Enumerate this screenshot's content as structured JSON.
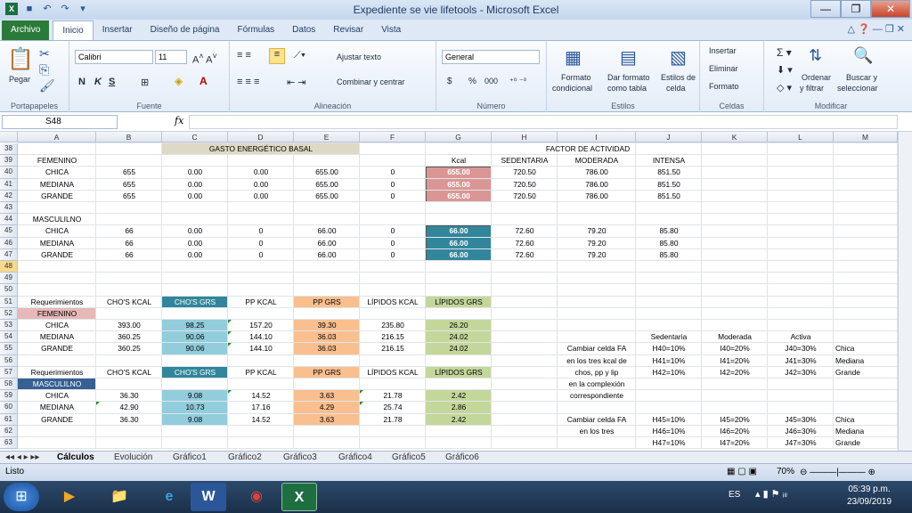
{
  "window": {
    "title": "Expediente se vie lifetools - Microsoft Excel",
    "minimize": "—",
    "restore": "❐",
    "close": "✕"
  },
  "ribbon_tabs": [
    "Archivo",
    "Inicio",
    "Insertar",
    "Diseño de página",
    "Fórmulas",
    "Datos",
    "Revisar",
    "Vista"
  ],
  "ribbon": {
    "portapapeles": {
      "paste": "Pegar",
      "label": "Portapapeles"
    },
    "fuente": {
      "font": "Calibri",
      "size": "11",
      "bold": "N",
      "italic": "K",
      "underline": "S",
      "label": "Fuente"
    },
    "alineacion": {
      "wrap": "Ajustar texto",
      "merge": "Combinar y centrar",
      "label": "Alineación"
    },
    "numero": {
      "format": "General",
      "label": "Número",
      "currency": "$",
      "percent": "%",
      "thousands": "000"
    },
    "estilos": {
      "cond1": "Formato",
      "cond2": "condicional",
      "table1": "Dar formato",
      "table2": "como tabla",
      "cell1": "Estilos de",
      "cell2": "celda",
      "label": "Estilos"
    },
    "celdas": {
      "insert": "Insertar",
      "delete": "Eliminar",
      "format": "Formato",
      "label": "Celdas"
    },
    "modificar": {
      "sort1": "Ordenar",
      "sort2": "y filtrar",
      "find1": "Buscar y",
      "find2": "seleccionar",
      "label": "Modificar"
    }
  },
  "formula_bar": {
    "name_box": "S48",
    "fx": "fx",
    "formula": ""
  },
  "columns": [
    "A",
    "B",
    "C",
    "D",
    "E",
    "F",
    "G",
    "H",
    "I",
    "J",
    "K",
    "L",
    "M"
  ],
  "rows": [
    "38",
    "39",
    "40",
    "41",
    "42",
    "43",
    "44",
    "45",
    "46",
    "47",
    "48",
    "49",
    "50",
    "51",
    "52",
    "53",
    "54",
    "55",
    "56",
    "57",
    "58",
    "59",
    "60",
    "61",
    "62",
    "63"
  ],
  "cells": {
    "r38": {
      "C": "GASTO ENERGÉTICO BASAL",
      "I": "FACTOR DE ACTIVIDAD"
    },
    "r39": {
      "A": "FEMENINO",
      "G": "Kcal",
      "H": "SEDENTARIA",
      "I": "MODERADA",
      "J": "INTENSA"
    },
    "r40": {
      "A": "CHICA",
      "B": "655",
      "C": "0.00",
      "D": "0.00",
      "E": "655.00",
      "F": "0",
      "G": "655.00",
      "H": "720.50",
      "I": "786.00",
      "J": "851.50"
    },
    "r41": {
      "A": "MEDIANA",
      "B": "655",
      "C": "0.00",
      "D": "0.00",
      "E": "655.00",
      "F": "0",
      "G": "655.00",
      "H": "720.50",
      "I": "786.00",
      "J": "851.50"
    },
    "r42": {
      "A": "GRANDE",
      "B": "655",
      "C": "0.00",
      "D": "0.00",
      "E": "655.00",
      "F": "0",
      "G": "655.00",
      "H": "720.50",
      "I": "786.00",
      "J": "851.50"
    },
    "r44": {
      "A": "MASCULILNO"
    },
    "r45": {
      "A": "CHICA",
      "B": "66",
      "C": "0.00",
      "D": "0",
      "E": "66.00",
      "F": "0",
      "G": "66.00",
      "H": "72.60",
      "I": "79.20",
      "J": "85.80"
    },
    "r46": {
      "A": "MEDIANA",
      "B": "66",
      "C": "0.00",
      "D": "0",
      "E": "66.00",
      "F": "0",
      "G": "66.00",
      "H": "72.60",
      "I": "79.20",
      "J": "85.80"
    },
    "r47": {
      "A": "GRANDE",
      "B": "66",
      "C": "0.00",
      "D": "0",
      "E": "66.00",
      "F": "0",
      "G": "66.00",
      "H": "72.60",
      "I": "79.20",
      "J": "85.80"
    },
    "r51": {
      "A": "Requerimientos",
      "B": "CHO'S KCAL",
      "C": "CHO'S GRS",
      "D": "PP KCAL",
      "E": "PP GRS",
      "F": "LÍPIDOS KCAL",
      "G": "LÍPIDOS GRS"
    },
    "r52": {
      "A": "FEMENINO"
    },
    "r53": {
      "A": "CHICA",
      "B": "393.00",
      "C": "98.25",
      "D": "157.20",
      "E": "39.30",
      "F": "235.80",
      "G": "26.20"
    },
    "r54": {
      "A": "MEDIANA",
      "B": "360.25",
      "C": "90.06",
      "D": "144.10",
      "E": "36.03",
      "F": "216.15",
      "G": "24.02",
      "J": "Sedentaria",
      "K": "Moderada",
      "L": "Activa"
    },
    "r55": {
      "A": "GRANDE",
      "B": "360.25",
      "C": "90.06",
      "D": "144.10",
      "E": "36.03",
      "F": "216.15",
      "G": "24.02",
      "I": "Cambiar celda FA",
      "J": "H40=10%",
      "K": "I40=20%",
      "L": "J40=30%",
      "M": "Chica"
    },
    "r56": {
      "I": "en los tres kcal de",
      "J": "H41=10%",
      "K": "I41=20%",
      "L": "J41=30%",
      "M": "Mediana"
    },
    "r57": {
      "A": "Requerimientos",
      "B": "CHO'S KCAL",
      "C": "CHO'S GRS",
      "D": "PP KCAL",
      "E": "PP GRS",
      "F": "LÍPIDOS KCAL",
      "G": "LÍPIDOS GRS",
      "I": "chos, pp y lip",
      "J": "H42=10%",
      "K": "I42=20%",
      "L": "J42=30%",
      "M": "Grande"
    },
    "r58": {
      "A": "MASCULILNO",
      "I": "en la complexión"
    },
    "r59": {
      "A": "CHICA",
      "B": "36.30",
      "C": "9.08",
      "D": "14.52",
      "E": "3.63",
      "F": "21.78",
      "G": "2.42",
      "I": "correspondiente"
    },
    "r60": {
      "A": "MEDIANA",
      "B": "42.90",
      "C": "10.73",
      "D": "17.16",
      "E": "4.29",
      "F": "25.74",
      "G": "2.86"
    },
    "r61": {
      "A": "GRANDE",
      "B": "36.30",
      "C": "9.08",
      "D": "14.52",
      "E": "3.63",
      "F": "21.78",
      "G": "2.42",
      "I": "Cambiar celda FA",
      "J": "H45=10%",
      "K": "I45=20%",
      "L": "J45=30%",
      "M": "Chica"
    },
    "r62": {
      "I": "en los tres",
      "J": "H46=10%",
      "K": "I46=20%",
      "L": "J46=30%",
      "M": "Mediana"
    },
    "r63": {
      "J": "H47=10%",
      "K": "I47=20%",
      "L": "J47=30%",
      "M": "Grande"
    }
  },
  "sheets": [
    "Cálculos",
    "Evolución",
    "Gráfico1",
    "Gráfico2",
    "Gráfico3",
    "Gráfico4",
    "Gráfico5",
    "Gráfico6"
  ],
  "status": {
    "ready": "Listo",
    "zoom": "70%"
  },
  "taskbar": {
    "lang": "ES",
    "time": "05:39 p.m.",
    "date": "23/09/2019"
  },
  "colors": {
    "tan": "#ddd9c4",
    "salmon": "#da9694",
    "teal": "#31869b",
    "lightblue": "#92cddc",
    "orange": "#fabf8f",
    "green": "#c4d79b",
    "pink": "#e6b8b7",
    "navy": "#366092"
  }
}
